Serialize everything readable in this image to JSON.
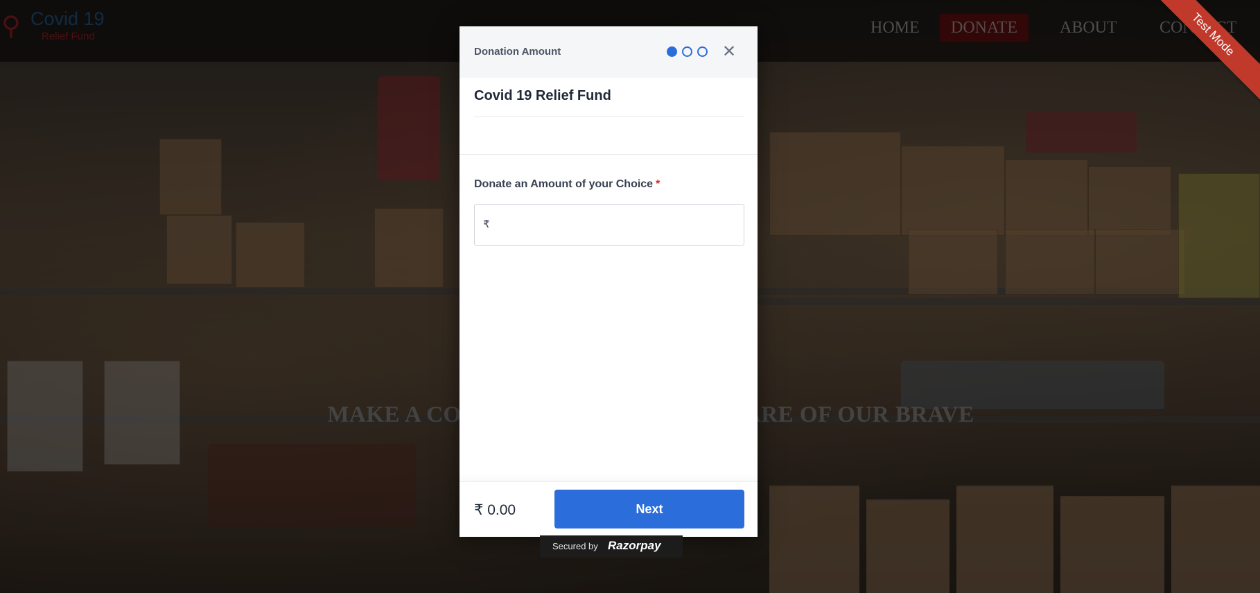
{
  "site": {
    "logo": {
      "title": "Covid 19",
      "subtitle": "Relief Fund",
      "icon": "person-icon"
    },
    "nav": [
      {
        "label": "HOME",
        "active": false
      },
      {
        "label": "DONATE",
        "active": true
      },
      {
        "label": "ABOUT",
        "active": false
      },
      {
        "label": "CONTACT",
        "active": false
      }
    ],
    "ribbon": "Test Mode",
    "hero_text": "MAKE A CONTRIBUTION TO TAKE CARE OF OUR BRAVE"
  },
  "modal": {
    "header_title": "Donation Amount",
    "steps": {
      "total": 3,
      "current": 1
    },
    "close_icon": "close-icon",
    "org_name": "Covid 19 Relief Fund",
    "amount_field": {
      "label": "Donate an Amount of your Choice",
      "required_mark": "*",
      "currency_symbol": "₹",
      "value": "",
      "placeholder": ""
    },
    "footer": {
      "total": "₹ 0.00",
      "next_label": "Next"
    }
  },
  "secured": {
    "text": "Secured by",
    "brand": "Razorpay"
  },
  "colors": {
    "primary": "#2b6ddb",
    "required": "#dc2626",
    "nav_active_bg": "#5a0d0f",
    "ribbon": "#c0392b"
  }
}
